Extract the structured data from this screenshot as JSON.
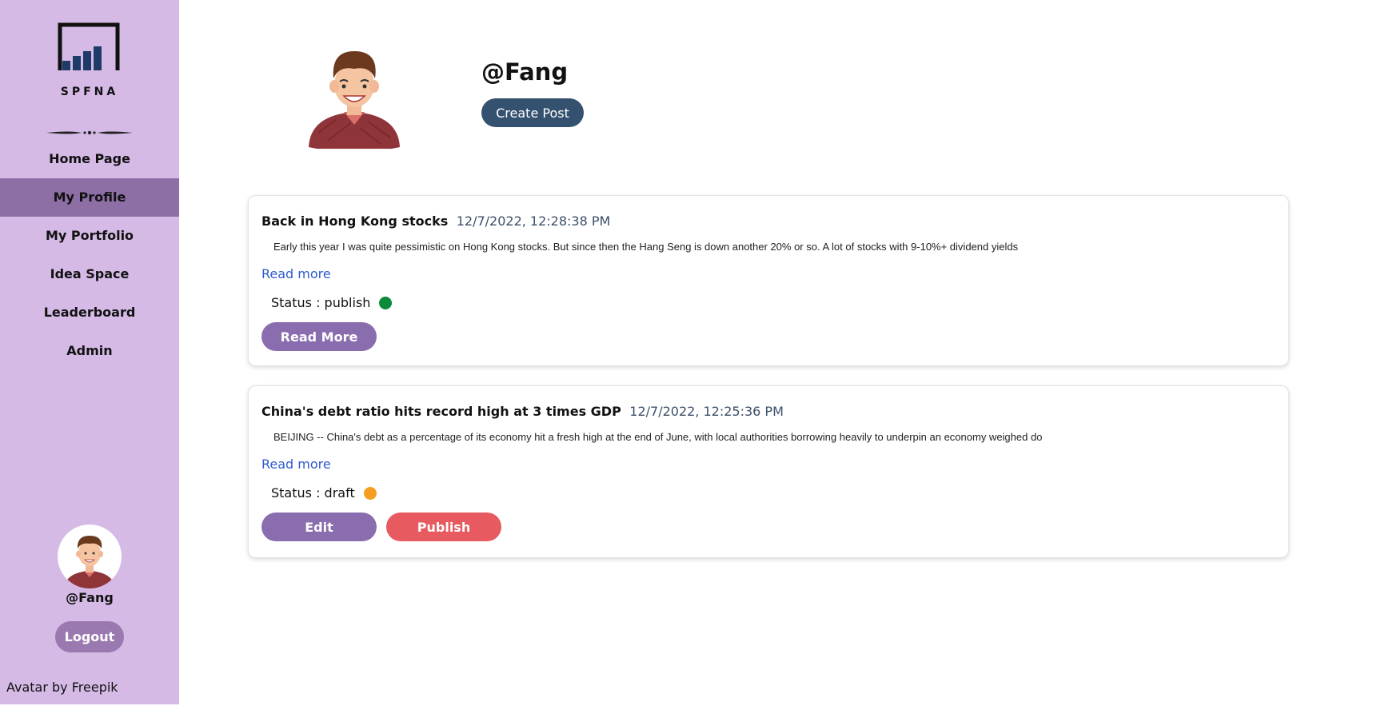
{
  "brand": {
    "logo_text": "SPFNA"
  },
  "sidebar": {
    "nav": [
      {
        "label": "Home Page",
        "active": false
      },
      {
        "label": "My Profile",
        "active": true
      },
      {
        "label": "My Portfolio",
        "active": false
      },
      {
        "label": "Idea Space",
        "active": false
      },
      {
        "label": "Leaderboard",
        "active": false
      },
      {
        "label": "Admin",
        "active": false
      }
    ],
    "username": "@Fang",
    "logout_label": "Logout",
    "credit": "Avatar by Freepik"
  },
  "profile": {
    "username": "@Fang",
    "create_post_label": "Create Post"
  },
  "posts": [
    {
      "title": "Back in Hong Kong stocks",
      "date": "12/7/2022, 12:28:38 PM",
      "excerpt": "Early this year I was quite pessimistic on Hong Kong stocks. But since then the Hang Seng is down another 20% or so. A lot of stocks with 9-10%+ dividend yields",
      "read_more_link": "Read more",
      "status": "Status : publish",
      "status_color": "#0a8a3a",
      "actions": [
        "Read More"
      ]
    },
    {
      "title": "China's debt ratio hits record high at 3 times GDP",
      "date": "12/7/2022, 12:25:36 PM",
      "excerpt": "BEIJING -- China's debt as a percentage of its economy hit a fresh high at the end of June, with local authorities borrowing heavily to underpin an economy weighed do",
      "read_more_link": "Read more",
      "status": "Status : draft",
      "status_color": "#f59e1f",
      "actions": [
        "Edit",
        "Publish"
      ]
    }
  ],
  "colors": {
    "sidebar_bg": "#d5bae6",
    "nav_active": "#8e6fa5",
    "primary_button": "#34516f",
    "purple_button": "#8a6daf",
    "red_button": "#e65a60"
  }
}
